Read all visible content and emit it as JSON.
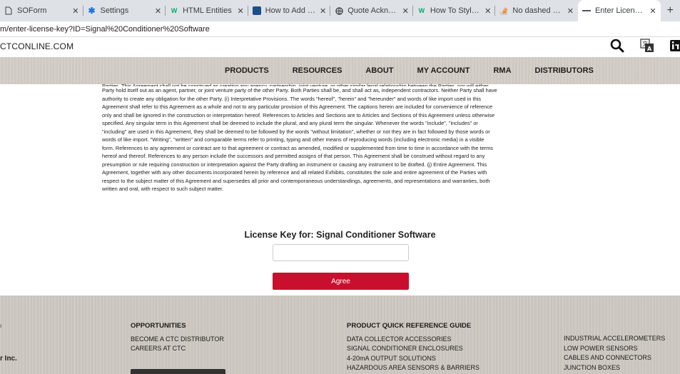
{
  "browser": {
    "tabs": [
      {
        "title": "SOForm",
        "icon": "page-icon"
      },
      {
        "title": "Settings",
        "icon": "gear-icon"
      },
      {
        "title": "HTML Entities",
        "icon": "w3schools-icon"
      },
      {
        "title": "How to Add a Border",
        "icon": "site-icon"
      },
      {
        "title": "Quote Acknowledgem",
        "icon": "globe-icon"
      },
      {
        "title": "How To Style the HR E",
        "icon": "w3schools-icon"
      },
      {
        "title": "No dashed border Ou",
        "icon": "stackoverflow-icon"
      },
      {
        "title": "Enter License Key | CT",
        "icon": "ctc-icon"
      }
    ],
    "new_tab_label": "+",
    "url": "m/enter-license-key?ID=Signal%20Conditioner%20Software"
  },
  "site": {
    "logo_text": "CTCONLINE.COM",
    "nav": [
      "PRODUCTS",
      "RESOURCES",
      "ABOUT",
      "MY ACCOUNT",
      "RMA",
      "DISTRIBUTORS"
    ]
  },
  "legal": {
    "cut_line": "Parties. This Agreement shall not be construed as creating any agency, partnership, joint venture, or other similar legal relationship between the Parties, nor will either",
    "lines": [
      "Party hold itself out as an agent, partner, or joint venture party of the other Party. Both Parties shall be, and shall act as, independent contractors. Neither Party shall have",
      "authority to create any obligation for the other Party. (i) Interpretative Provisions. The words \"hereof\", \"herein\" and \"hereunder\" and words of like import used in this",
      "Agreement shall refer to this Agreement as a whole and not to any particular provision of this Agreement. The captions herein are included for convenience of reference",
      "only and shall be ignored in the construction or interpretation hereof. References to Articles and Sections are to Articles and Sections of this Agreement unless otherwise",
      "specified. Any singular term in this Agreement shall be deemed to include the plural, and any plural term the singular. Whenever the words \"include\", \"includes\" or",
      "\"including\" are used in this Agreement, they shall be deemed to be followed by the words \"without limitation\", whether or not they are in fact followed by those words or",
      "words of like import. \"Writing\", \"written\" and comparable terms refer to printing, typing and other means of reproducing words (including electronic media) in a visible",
      "form. References to any agreement or contract are to that agreement or contract as amended, modified or supplemented from time to time in accordance with the terms",
      "hereof and thereof. References to any person include the successors and permitted assigns of that person. This Agreement shall be construed without regard to any",
      "presumption or rule requiring construction or interpretation against the Party drafting an instrument or causing any instrument to be drafted. (j) Entire Agreement. This",
      "Agreement, together with any other documents incorporated herein by reference and all related Exhibits, constitutes the sole and entire agreement of the Parties with",
      "respect to the subject matter of this Agreement and supersedes all prior and contemporaneous understandings, agreements, and representations and warranties, both",
      "written and oral, with respect to such subject matter."
    ]
  },
  "license": {
    "title": "License Key for: Signal Conditioner Software",
    "input_value": "",
    "input_placeholder": "",
    "agree_label": "Agree"
  },
  "footer": {
    "left_text": "r Inc.",
    "opportunities": {
      "heading": "OPPORTUNITIES",
      "items": [
        "BECOME A CTC DISTRIBUTOR",
        "CAREERS AT CTC"
      ]
    },
    "quick_ref": {
      "heading": "PRODUCT QUICK REFERENCE GUIDE",
      "items": [
        "DATA COLLECTOR ACCESSORIES",
        "SIGNAL CONDITIONER ENCLOSURES",
        "4-20mA OUTPUT SOLUTIONS",
        "HAZARDOUS AREA SENSORS & BARRIERS"
      ]
    },
    "right_col": {
      "items": [
        "INDUSTRIAL ACCELEROMETERS",
        "LOW POWER SENSORS",
        "CABLES AND CONNECTORS",
        "JUNCTION BOXES"
      ]
    }
  },
  "colors": {
    "accent": "#c8102e",
    "nav_bg": "#d1cbc4",
    "tabbar_bg": "#dee1e6"
  }
}
